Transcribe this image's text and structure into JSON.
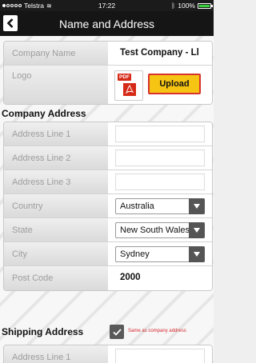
{
  "status_bar": {
    "carrier": "Telstra",
    "time": "17:22",
    "battery": "100%"
  },
  "nav": {
    "title": "Name and Address"
  },
  "company": {
    "name_label": "Company Name",
    "name_value": "Test Company - Ll",
    "logo_label": "Logo",
    "pdf_tag": "PDF",
    "upload_label": "Upload"
  },
  "company_address": {
    "title": "Company Address",
    "line1_label": "Address Line 1",
    "line1_value": "",
    "line2_label": "Address Line 2",
    "line2_value": "",
    "line3_label": "Address Line 3",
    "line3_value": "",
    "country_label": "Country",
    "country_value": "Australia",
    "state_label": "State",
    "state_value": "New South Wales",
    "city_label": "City",
    "city_value": "Sydney",
    "postcode_label": "Post Code",
    "postcode_value": "2000"
  },
  "shipping": {
    "title": "Shipping Address",
    "same_checked": true,
    "same_label": "Same as company address",
    "line1_label": "Address Line 1"
  },
  "colors": {
    "accent_yellow": "#f6c514",
    "accent_red": "#d62a18",
    "navbar": "#151515"
  }
}
